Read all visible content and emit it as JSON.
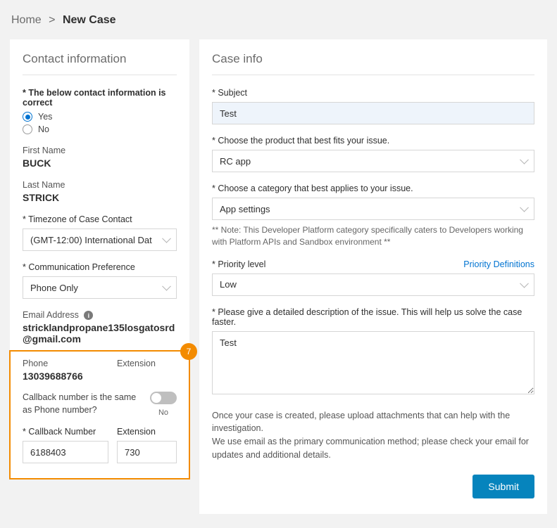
{
  "breadcrumb": {
    "home": "Home",
    "current": "New Case"
  },
  "contact": {
    "title": "Contact information",
    "confirm_label": "* The below contact information is correct",
    "yes": "Yes",
    "no": "No",
    "first_name_label": "First Name",
    "first_name": "BUCK",
    "last_name_label": "Last Name",
    "last_name": "STRICK",
    "timezone_label": "* Timezone of Case Contact",
    "timezone_value": "(GMT-12:00) International Dat",
    "comm_pref_label": "* Communication Preference",
    "comm_pref_value": "Phone Only",
    "email_label": "Email Address",
    "email_value": "stricklandpropane135losgatosrd@gmail.com",
    "phone_label": "Phone",
    "extension_label": "Extension",
    "phone_value": "13039688766",
    "callback_same_label": "Callback number is the same as Phone number?",
    "toggle_no": "No",
    "callback_number_label": "* Callback Number",
    "callback_number_value": "6188403",
    "callback_ext_value": "730",
    "badge": "7"
  },
  "caseinfo": {
    "title": "Case info",
    "subject_label": "* Subject",
    "subject_value": "Test",
    "product_label": "* Choose the product that best fits your issue.",
    "product_value": "RC app",
    "category_label": "* Choose a category that best applies to your issue.",
    "category_value": "App settings",
    "category_note": "** Note: This Developer Platform category specifically caters to Developers working with Platform APIs and Sandbox environment **",
    "priority_label": "* Priority level",
    "priority_link": "Priority Definitions",
    "priority_value": "Low",
    "description_label": "* Please give a detailed description of the issue. This will help us solve the case faster.",
    "description_value": "Test",
    "footer_note": "Once your case is created, please upload attachments that can help with the investigation.\nWe use email as the primary communication method; please check your email for updates and additional details.",
    "submit": "Submit"
  }
}
